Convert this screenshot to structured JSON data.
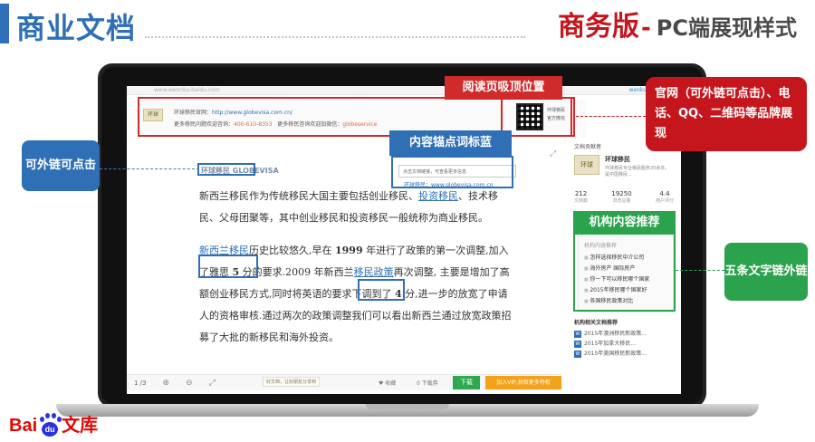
{
  "slide": {
    "title_left": "商业文档",
    "title_right_main": "商务版",
    "title_right_dash": "-",
    "title_right_sub": "PC端展现样式"
  },
  "browser": {
    "url_text": "www.ewenku.baidu.com",
    "logo_text": "wenku"
  },
  "brand_bar": {
    "logo_text": "环球",
    "line1_label": "环球移民官网：",
    "line1_url": "http://www.globevisa.com.cn/",
    "line2_label": "更多移民问题欢迎咨询：",
    "line2_phone": "400-610-8353",
    "line2_wechat_label": "更多移民咨询欢迎加微信：",
    "line2_wechat": "globeservice",
    "qr_caption": "环球移民\n官方微信"
  },
  "right_panel": {
    "header": "文档贡献者",
    "org_name": "环球移民",
    "org_desc": "环球移民专业移民服务20余年，是中国移民...",
    "stats": [
      {
        "value": "212",
        "label": "文档数"
      },
      {
        "value": "19250",
        "label": "浏览总量"
      },
      {
        "value": "4.4",
        "label": "用户评分"
      }
    ],
    "rec_title": "机构内容推荐",
    "rec_items": [
      "怎样选择移民中介公司",
      "海外房产 国际房产",
      "你一下可以移民哪个国家",
      "2015年移民哪个国家好",
      "各国移民政策对比"
    ],
    "related_title": "机构相关文档推荐",
    "related_items": [
      "2015年澳洲移民新政策...",
      "2015年加拿大移民...",
      "2015年美国移民新政策..."
    ]
  },
  "document": {
    "watermark": "环球移民 GLOBEVISA",
    "tooltip": "点击文档链接，可查看更多信息",
    "tooltip_url": "环球移民：www.globevisa.com.cn",
    "p1_a": "新西兰移民作为传统移民大国主要包括创业移民、",
    "p1_kw": "投资移民",
    "p1_b": "、技术移民、父母团聚等，其中创业移民和投资移民一般统称为商业移民。",
    "p2_kw1": "新西兰移民",
    "p2_a": "历史比较悠久,早在 ",
    "p2_year": "1999",
    "p2_b": " 年进行了政策的第一次调整,加入了雅思 ",
    "p2_n5": "5",
    "p2_c": " 分的要求.2009 年新西兰",
    "p2_kw2": "移民政策",
    "p2_d": "再次调整, 主要是增加了高额创业移民方式,同时将英语的要求下调到了 ",
    "p2_n4": "4",
    "p2_e": " 分,进一步的放宽了申请人的资格审核.通过两次的政策调整我们可以看出新西兰通过放宽政策招募了大批的新移民和海外投资。"
  },
  "toolbar": {
    "page": "1 /3",
    "hint": "好文档，让好朋友分享到",
    "fav": "收藏",
    "download_info": "0 下载券",
    "download": "下载",
    "vip": "加入VIP,获取更多特权"
  },
  "callouts": {
    "top_red": "阅读页吸顶位置",
    "right_red": "官网（可外链可点击）、电话、QQ、二维码等品牌展现",
    "mid_blue": "内容锚点词标蓝",
    "left_blue": "可外链可点击",
    "mid_green": "机构内容推荐",
    "right_green": "五条文字链外链"
  },
  "footer": {
    "logo_bai": "Bai",
    "logo_du": "du",
    "logo_ku": "文库"
  },
  "colors": {
    "accent_blue": "#2e6fb6",
    "red": "#c4161c",
    "green": "#2ba24c"
  }
}
